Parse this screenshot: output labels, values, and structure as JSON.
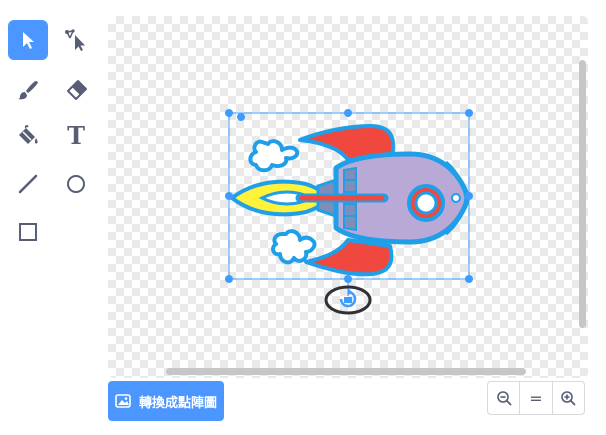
{
  "tools": [
    {
      "name": "select",
      "icon": "arrow-pointer-icon",
      "selected": true
    },
    {
      "name": "reshape",
      "icon": "reshape-pointer-icon"
    },
    {
      "name": "brush",
      "icon": "brush-icon"
    },
    {
      "name": "eraser",
      "icon": "eraser-icon"
    },
    {
      "name": "fill",
      "icon": "paint-bucket-icon"
    },
    {
      "name": "text",
      "icon": "text-icon",
      "label": "T"
    },
    {
      "name": "line",
      "icon": "line-icon"
    },
    {
      "name": "circle",
      "icon": "circle-icon"
    },
    {
      "name": "rectangle",
      "icon": "rectangle-icon"
    }
  ],
  "convert_button": {
    "label": "轉換成點陣圖",
    "icon": "image-icon"
  },
  "zoom": {
    "zoom_out_icon": "zoom-out-icon",
    "reset_label": "=",
    "zoom_in_icon": "zoom-in-icon"
  },
  "colors": {
    "accent": "#4c97ff",
    "selection": "#3d9cff",
    "rocket_outline": "#1f9fe8",
    "rocket_body": "#b9a9d6",
    "rocket_fin": "#f0473f",
    "flame": "#ffef3a"
  }
}
